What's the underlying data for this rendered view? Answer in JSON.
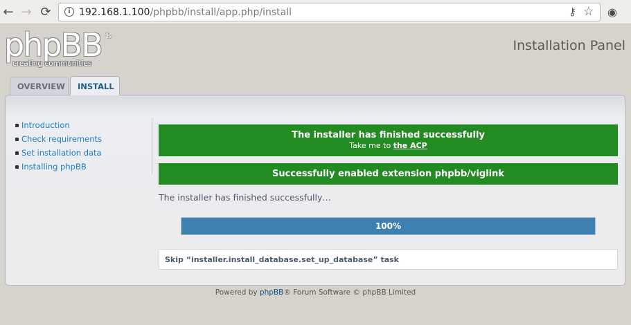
{
  "browser": {
    "url_host": "192.168.1.100",
    "url_path": "/phpbb/install/app.php/install",
    "back_glyph": "←",
    "forward_glyph": "→",
    "reload_glyph": "⟳",
    "info_glyph": "i",
    "key_glyph": "⚷",
    "star_glyph": "☆",
    "ext_glyph": "◉"
  },
  "logo": {
    "main": "phpBB",
    "reg": "®",
    "tagline": "creating   communities"
  },
  "header": {
    "title": "Installation Panel"
  },
  "tabs": [
    {
      "label": "OVERVIEW",
      "active": false
    },
    {
      "label": "INSTALL",
      "active": true
    }
  ],
  "sidebar": {
    "items": [
      {
        "label": "Introduction"
      },
      {
        "label": "Check requirements"
      },
      {
        "label": "Set installation data"
      },
      {
        "label": "Installing phpBB"
      }
    ]
  },
  "messages": {
    "success_title": "The installer has finished successfully",
    "success_sub_prefix": "Take me to ",
    "success_sub_link": "the ACP",
    "extension_title": "Successfully enabled extension phpbb/viglink",
    "status": "The installer has finished successfully…"
  },
  "progress": {
    "label": "100%",
    "value": 1.0
  },
  "skip": {
    "text": "Skip “installer.install_database.set_up_database” task"
  },
  "footer": {
    "prefix": "Powered by ",
    "brand": "phpBB",
    "suffix": "® Forum Software © phpBB Limited"
  },
  "colors": {
    "success_bg": "#228b22",
    "progress_fill": "#3d81b1",
    "link": "#1a7ec0",
    "page_bg": "#d6d2cc"
  }
}
